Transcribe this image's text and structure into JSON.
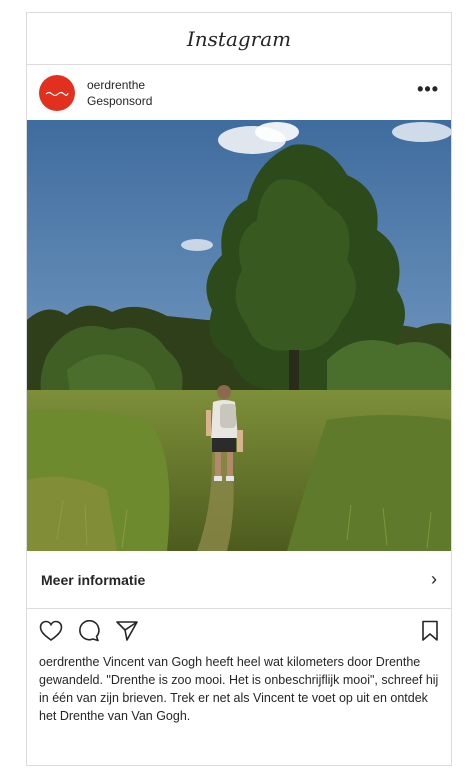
{
  "header": {
    "logo_text": "Instagram"
  },
  "post": {
    "username": "oerdrenthe",
    "label": "Gesponsord",
    "more": "•••"
  },
  "cta": {
    "label": "Meer informatie",
    "chevron": "›"
  },
  "actions": {
    "like_icon": "heart-icon",
    "comment_icon": "comment-icon",
    "share_icon": "send-icon",
    "save_icon": "bookmark-icon"
  },
  "caption": {
    "username": "oerdrenthe",
    "text": " Vincent van Gogh heeft heel wat kilometers door Drenthe gewandeld. \"Drenthe is zoo mooi. Het is onbeschrijflijk mooi\", schreef hij in één van zijn brieven. Trek er net als Vincent te voet op uit en ontdek het Drenthe van Van Gogh."
  },
  "colors": {
    "brand_avatar": "#e1301e",
    "border": "#dbdbdb",
    "text": "#262626"
  }
}
